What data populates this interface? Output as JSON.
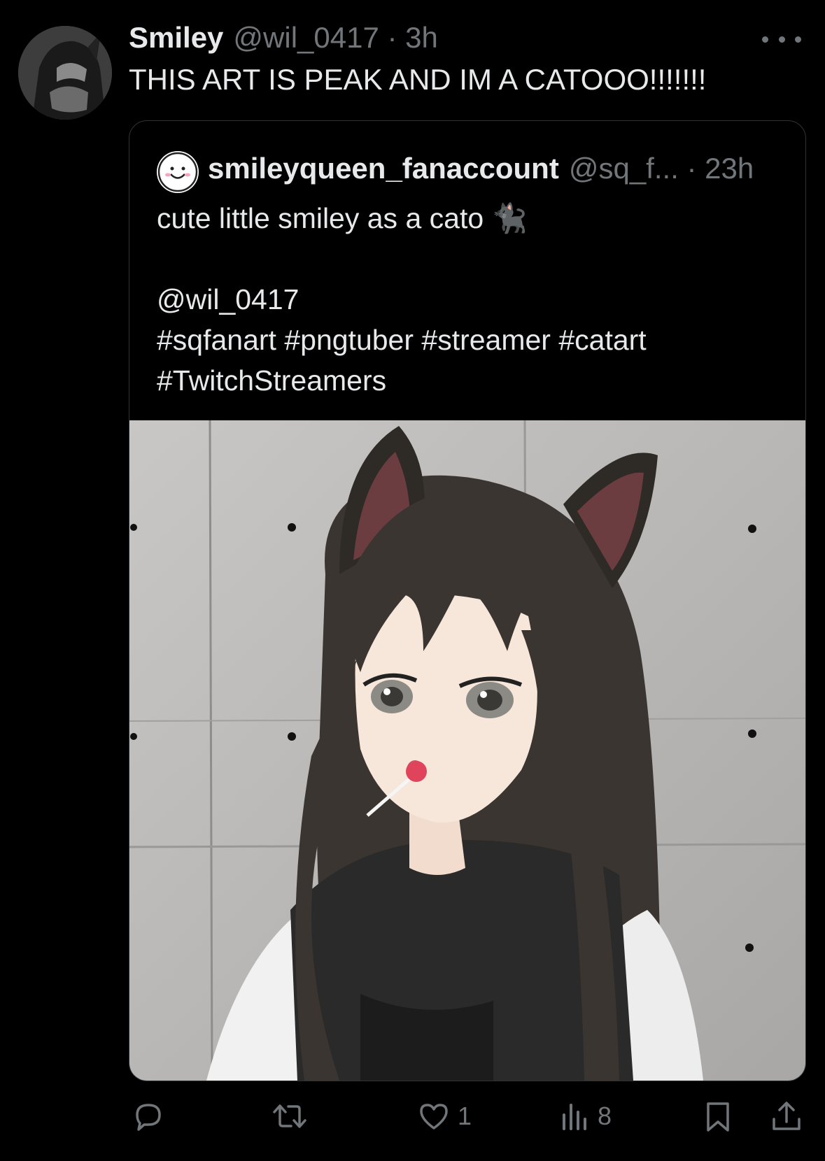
{
  "tweet": {
    "display_name": "Smiley",
    "handle_time": "@wil_0417 · 3h",
    "text": "THIS ART IS PEAK AND IM A CATOOO!!!!!!!"
  },
  "quote": {
    "display_name": "smileyqueen_fanaccount",
    "handle_time": "@sq_f... · 23h",
    "lines": [
      "cute little smiley as a cato 🐈‍⬛",
      "",
      "@wil_0417",
      "#sqfanart #pngtuber #streamer #catart",
      "#TwitchStreamers"
    ],
    "image_icon": "anime-cat-girl-artwork"
  },
  "actions": {
    "reply_icon": "reply-icon",
    "retweet_icon": "retweet-icon",
    "like_icon": "heart-icon",
    "like_count": "1",
    "views_icon": "views-icon",
    "views_count": "8",
    "bookmark_icon": "bookmark-icon",
    "share_icon": "share-icon"
  },
  "colors": {
    "background": "#000000",
    "text": "#e7e9ea",
    "muted": "#71767b",
    "border": "#2f3336"
  }
}
